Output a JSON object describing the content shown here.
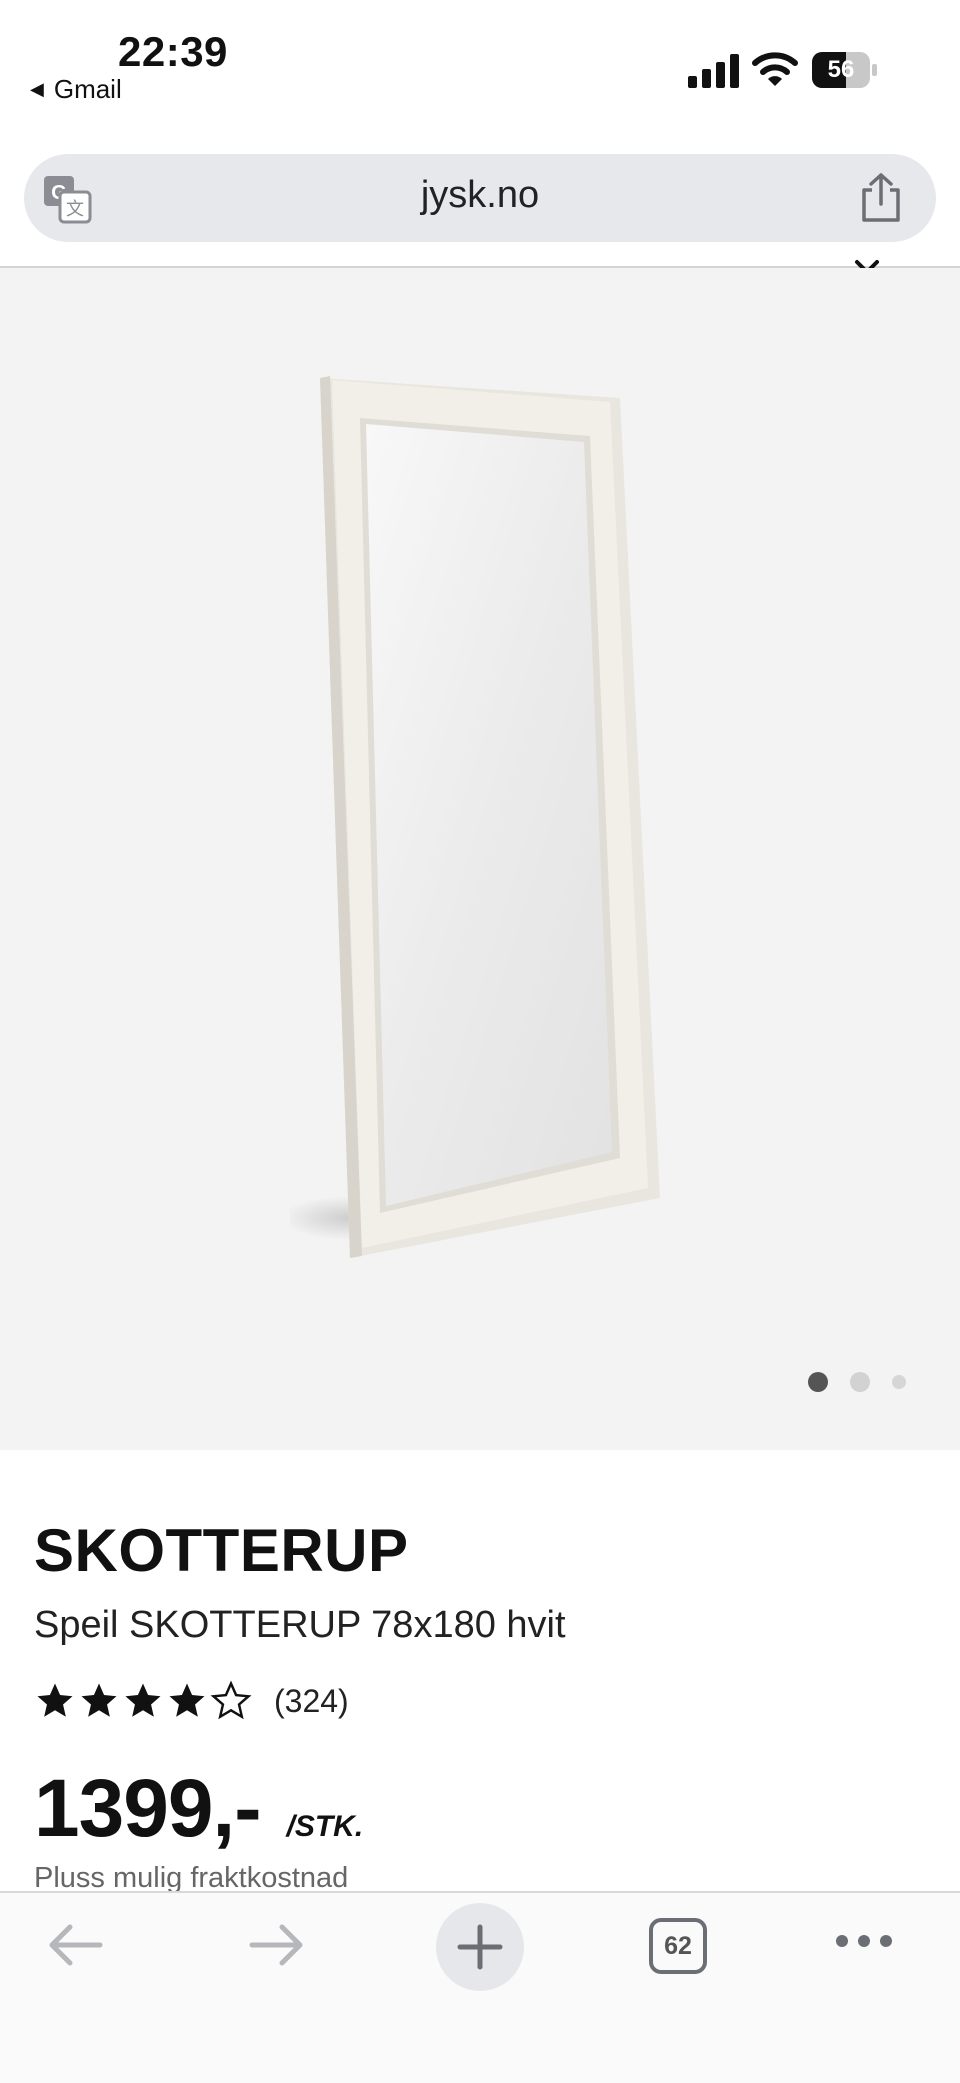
{
  "status_bar": {
    "time": "22:39",
    "back_app": "Gmail",
    "battery_level": "56"
  },
  "browser": {
    "url": "jysk.no",
    "tabs_count": "62"
  },
  "gallery": {
    "image_description": "mirror-product-image",
    "active_index": 1,
    "total_images": 3
  },
  "product": {
    "brand": "SKOTTERUP",
    "name": "Speil SKOTTERUP 78x180 hvit",
    "rating_stars": 4,
    "rating_max": 5,
    "review_count": "(324)",
    "price": "1399,-",
    "unit": "/STK.",
    "shipping_note": "Pluss mulig fraktkostnad"
  },
  "colors": {
    "accent_dark": "#111111",
    "url_bar_bg": "#e6e8ec",
    "gallery_bg": "#f3f3f3"
  },
  "icons": {
    "translate": "translate-icon",
    "share": "share-icon",
    "back": "arrow-left-icon",
    "forward": "arrow-right-icon",
    "new_tab": "plus-icon",
    "tabs": "tabs-icon",
    "more": "more-icon"
  }
}
